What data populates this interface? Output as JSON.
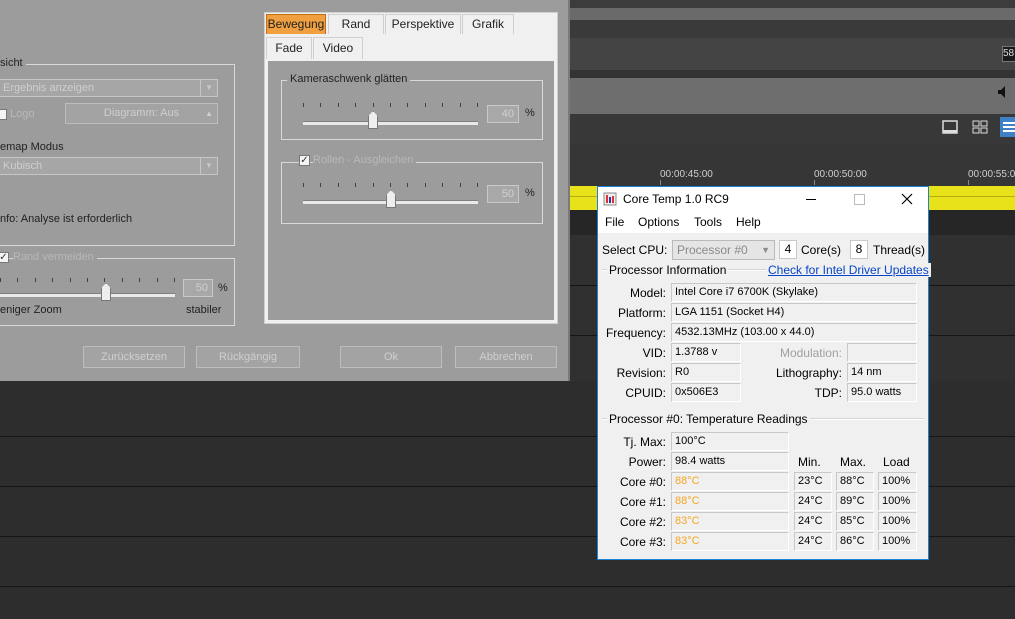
{
  "editor": {
    "timecodes": [
      "00:00:45:00",
      "00:00:50:00",
      "00:00:55:0"
    ],
    "badge_value": "58"
  },
  "camera_dialog": {
    "left_panel": {
      "group1_title": "sicht",
      "result_combo": "Ergebnis anzeigen",
      "logo_label": "Logo",
      "diagram_button": "Diagramm: Aus",
      "remap_label": "emap Modus",
      "remap_combo": "Kubisch",
      "info_text": "nfo: Analyse ist erforderlich",
      "avoid_border_label": "Rand vermeiden",
      "zoom_value": "50",
      "zoom_unit": "%",
      "less_zoom_label": "eniger Zoom",
      "more_stable_label": "stabiler",
      "avoid_border_level": 0.48
    },
    "tabs_row1": [
      "Bewegung",
      "Rand",
      "Perspektive",
      "Grafik"
    ],
    "tabs_row2": [
      "Fade",
      "Video"
    ],
    "pan_group": {
      "title": "Kameraschwenk glätten",
      "value": "40",
      "unit": "%",
      "level": 0.4
    },
    "roll_group": {
      "checkbox_label": "Rollen - Ausgleichen",
      "value": "50",
      "unit": "%",
      "level": 0.5
    },
    "buttons": {
      "reset": "Zurücksetzen",
      "undo": "Rückgängig",
      "ok": "Ok",
      "cancel": "Abbrechen"
    }
  },
  "coretemp": {
    "title": "Core Temp 1.0 RC9",
    "menu": [
      "File",
      "Options",
      "Tools",
      "Help"
    ],
    "select_cpu_label": "Select CPU:",
    "cpu_select_value": "Processor #0",
    "cores_count": "4",
    "cores_label": "Core(s)",
    "threads_count": "8",
    "threads_label": "Thread(s)",
    "processor_info_label": "Processor Information",
    "driver_link": "Check for Intel Driver Updates",
    "model_label": "Model:",
    "model_value": "Intel Core i7 6700K (Skylake)",
    "platform_label": "Platform:",
    "platform_value": "LGA 1151 (Socket H4)",
    "frequency_label": "Frequency:",
    "frequency_value": "4532.13MHz (103.00 x 44.0)",
    "vid_label": "VID:",
    "vid_value": "1.3788 v",
    "modulation_label": "Modulation:",
    "modulation_value": "",
    "revision_label": "Revision:",
    "revision_value": "R0",
    "lithography_label": "Lithography:",
    "lithography_value": "14 nm",
    "cpuid_label": "CPUID:",
    "cpuid_value": "0x506E3",
    "tdp_label": "TDP:",
    "tdp_value": "95.0 watts",
    "temp_section_label": "Processor #0: Temperature Readings",
    "tjmax_label": "Tj. Max:",
    "tjmax_value": "100°C",
    "power_label": "Power:",
    "power_value": "98.4 watts",
    "col_min": "Min.",
    "col_max": "Max.",
    "col_load": "Load",
    "cores": [
      {
        "label": "Core #0:",
        "temp": "88°C",
        "min": "23°C",
        "max": "88°C",
        "load": "100%"
      },
      {
        "label": "Core #1:",
        "temp": "88°C",
        "min": "24°C",
        "max": "89°C",
        "load": "100%"
      },
      {
        "label": "Core #2:",
        "temp": "83°C",
        "min": "24°C",
        "max": "85°C",
        "load": "100%"
      },
      {
        "label": "Core #3:",
        "temp": "83°C",
        "min": "24°C",
        "max": "86°C",
        "load": "100%"
      }
    ],
    "colors": {
      "accent": "#1883d7",
      "hot": "#f5a623",
      "link": "#0645c8"
    }
  }
}
